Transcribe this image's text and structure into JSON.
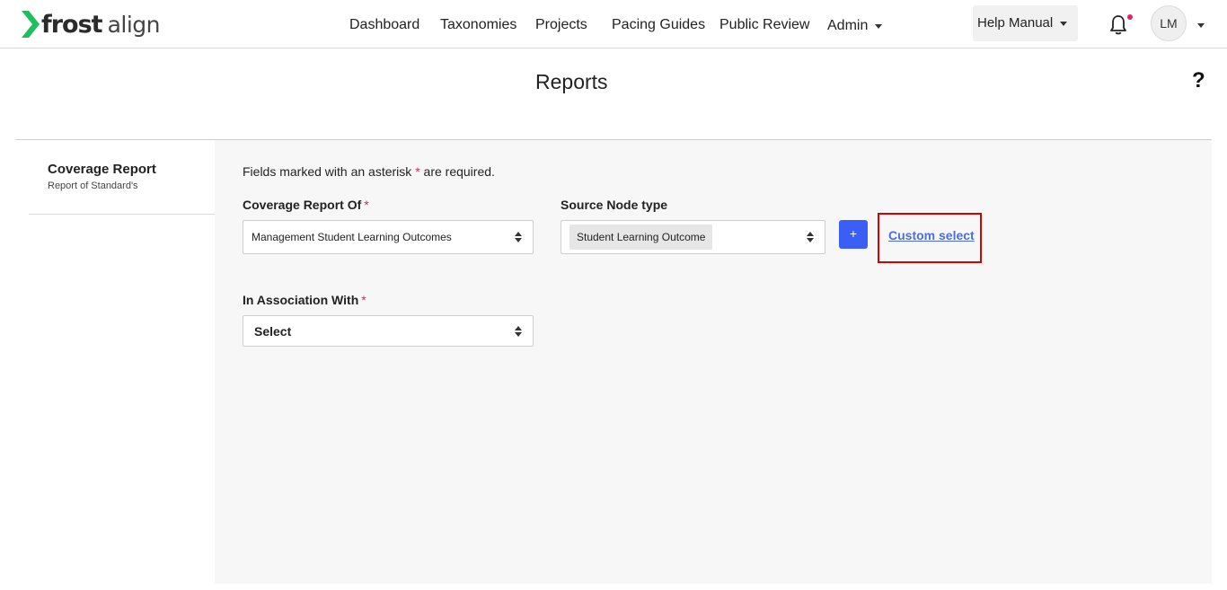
{
  "app": {
    "logo_bold": "frost",
    "logo_light": "align",
    "brand_color": "#1fbf5f"
  },
  "nav": {
    "items": [
      {
        "label": "Dashboard"
      },
      {
        "label": "Taxonomies"
      },
      {
        "label": "Projects"
      },
      {
        "label": "Pacing Guides"
      },
      {
        "label": "Public Review"
      },
      {
        "label": "Admin"
      }
    ],
    "help_manual": "Help Manual",
    "avatar_initials": "LM",
    "notification_icon": "bell-icon"
  },
  "page": {
    "title": "Reports",
    "help_icon": "?"
  },
  "sidebar": {
    "items": [
      {
        "title": "Coverage Report",
        "subtitle": "Report of Standard's"
      }
    ]
  },
  "form": {
    "required_note_before": "Fields marked with an asterisk",
    "required_star": "*",
    "required_note_after": "are required.",
    "coverage_of": {
      "label": "Coverage Report Of",
      "value": "Management Student Learning Outcomes"
    },
    "source_node_type": {
      "label": "Source Node type",
      "chip": "Student Learning Outcome"
    },
    "add_button": "+",
    "custom_select": "Custom select",
    "association": {
      "label": "In Association With",
      "value": "Select"
    }
  },
  "colors": {
    "accent": "#3b5ff6",
    "link": "#4e6de0",
    "required": "#e0245e",
    "highlight": "#d50000"
  }
}
